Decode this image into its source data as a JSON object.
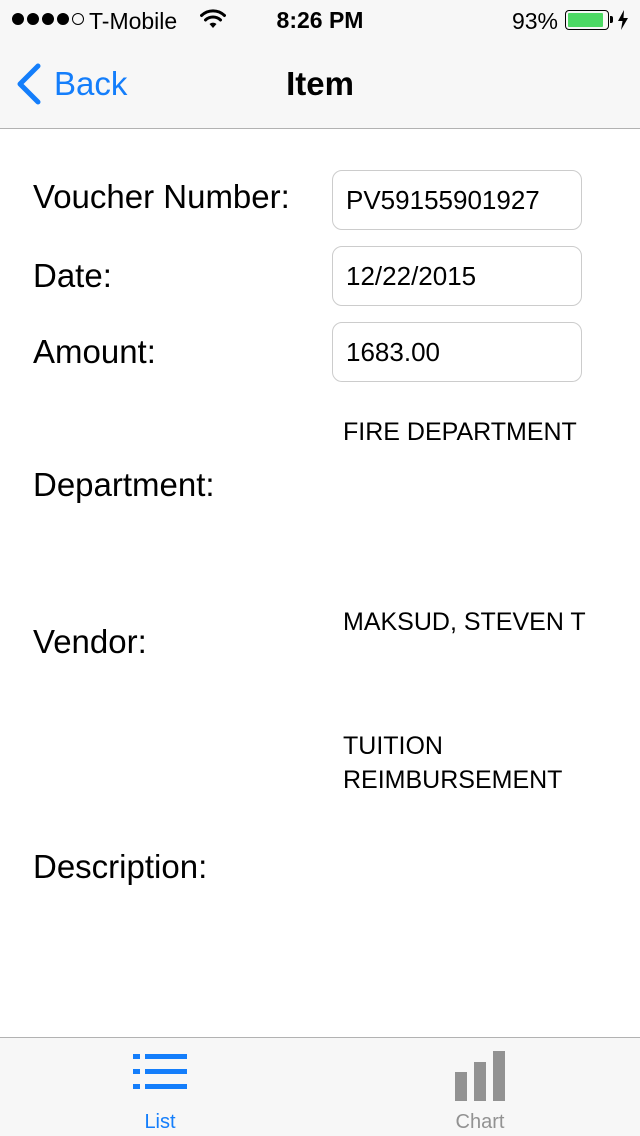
{
  "status_bar": {
    "carrier": "T-Mobile",
    "time": "8:26 PM",
    "battery_percent": "93%",
    "battery_level": 0.93,
    "signal_bars": 4,
    "signal_max": 5
  },
  "nav": {
    "back_label": "Back",
    "title": "Item"
  },
  "form": {
    "voucher_number_label": "Voucher Number:",
    "voucher_number_value": "PV59155901927",
    "date_label": "Date:",
    "date_value": "12/22/2015",
    "amount_label": "Amount:",
    "amount_value": "1683.00",
    "department_label": "Department:",
    "department_value": "FIRE DEPARTMENT",
    "vendor_label": "Vendor:",
    "vendor_value": "MAKSUD, STEVEN T",
    "description_label": "Description:",
    "description_value": "TUITION REIMBURSEMENT"
  },
  "tab_bar": {
    "tabs": [
      {
        "label": "List",
        "icon": "list-icon",
        "selected": true
      },
      {
        "label": "Chart",
        "icon": "bar-chart-icon",
        "selected": false
      }
    ]
  },
  "colors": {
    "accent": "#147efb",
    "inactive_tab": "#929292",
    "battery": "#4cd964",
    "bar_background": "#f7f7f7"
  }
}
